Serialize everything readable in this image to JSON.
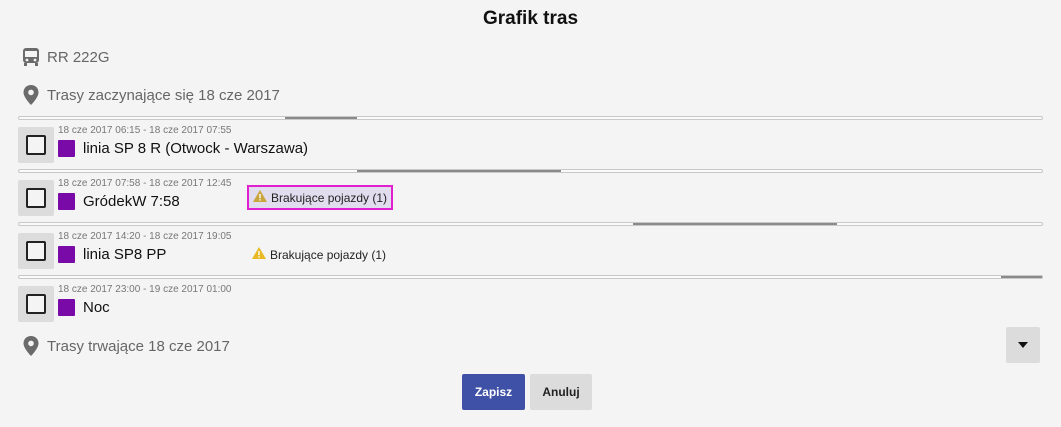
{
  "dialog": {
    "title": "Grafik tras"
  },
  "vehicle": {
    "icon": "bus-icon",
    "label": "RR 222G"
  },
  "routes_start": {
    "icon": "map-marker-icon",
    "label": "Trasy zaczynające się 18 cze 2017"
  },
  "routes_during": {
    "icon": "map-marker-icon",
    "label": "Trasy trwające 18 cze 2017"
  },
  "timelines": [
    {
      "start": 0.26,
      "end": 0.33
    },
    {
      "start": 0.33,
      "end": 0.53
    },
    {
      "start": 0.6,
      "end": 0.8
    },
    {
      "start": 0.96,
      "end": 1.0
    }
  ],
  "routes": [
    {
      "time": "18 cze 2017 06:15 - 18 cze 2017 07:55",
      "name": "linia SP 8 R (Otwock - Warszawa)",
      "color": "#7a0aa8",
      "warning": ""
    },
    {
      "time": "18 cze 2017 07:58 - 18 cze 2017 12:45",
      "name": "GródekW 7:58",
      "color": "#7a0aa8",
      "warning": "Brakujące pojazdy (1)"
    },
    {
      "time": "18 cze 2017 14:20 - 18 cze 2017 19:05",
      "name": "linia SP8 PP",
      "color": "#7a0aa8",
      "warning": "Brakujące pojazdy (1)"
    },
    {
      "time": "18 cze 2017 23:00 - 19 cze 2017 01:00",
      "name": "Noc",
      "color": "#7a0aa8",
      "warning": ""
    }
  ],
  "buttons": {
    "save": "Zapisz",
    "cancel": "Anuluj"
  },
  "dropdown": {
    "icon": "caret-down-icon"
  },
  "colors": {
    "primary": "#3f51a6",
    "highlight": "#e020d0",
    "warning": "#e8b923"
  }
}
